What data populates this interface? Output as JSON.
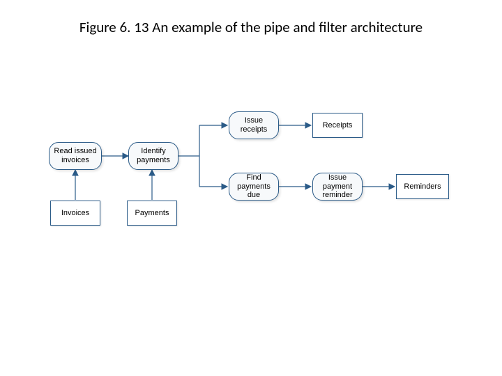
{
  "title": "Figure 6. 13 An example of the pipe and filter architecture",
  "nodes": {
    "read_issued_invoices": "Read issued invoices",
    "identify_payments": "Identify payments",
    "issue_receipts": "Issue receipts",
    "find_payments_due": "Find payments due",
    "issue_payment_reminder": "Issue payment reminder",
    "invoices": "Invoices",
    "payments": "Payments",
    "receipts": "Receipts",
    "reminders": "Reminders"
  }
}
